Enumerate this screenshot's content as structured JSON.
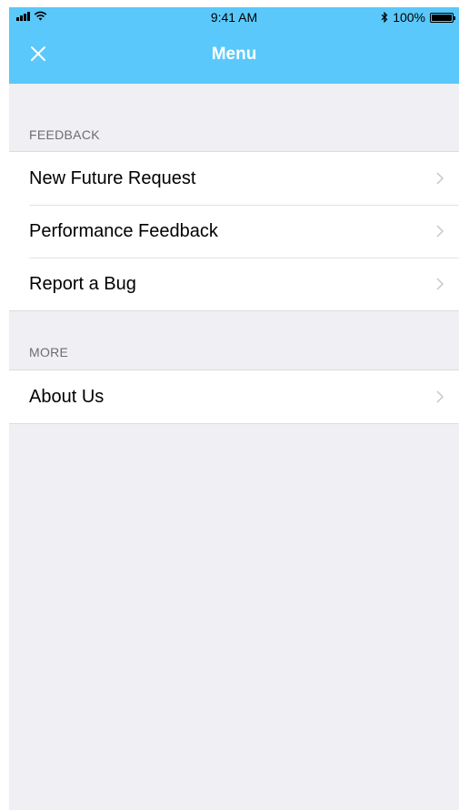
{
  "status_bar": {
    "time": "9:41 AM",
    "battery": "100%",
    "icons": [
      "signal-icon",
      "wifi-icon",
      "bluetooth-icon",
      "battery-icon"
    ]
  },
  "nav": {
    "title": "Menu",
    "close_icon": "close-icon"
  },
  "sections": {
    "feedback": {
      "header": "FEEDBACK",
      "items": [
        {
          "label": "New Future Request"
        },
        {
          "label": "Performance Feedback"
        },
        {
          "label": "Report a Bug"
        }
      ]
    },
    "more": {
      "header": "MORE",
      "items": [
        {
          "label": "About Us"
        }
      ]
    }
  },
  "colors": {
    "accent": "#5ac8fa",
    "background": "#efeff4",
    "section_header": "#6d6d72",
    "chevron": "#c7c7cc"
  }
}
